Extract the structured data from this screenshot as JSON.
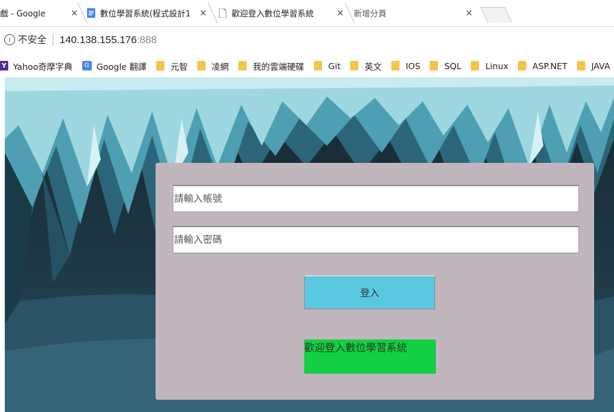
{
  "tabs": [
    {
      "label": "戲 - Google",
      "active": false
    },
    {
      "label": "數位學習系統(程式設計1",
      "active": false
    },
    {
      "label": "歡迎登入數位學習系統",
      "active": true
    },
    {
      "label": "新增分頁",
      "active": false
    }
  ],
  "tab_close": "×",
  "address": {
    "info_icon": "ⓘ",
    "security_label": "不安全",
    "url_host": "140.138.155.176",
    "url_port": ":888"
  },
  "bookmarks": [
    {
      "label": "Yahoo奇摩字典",
      "icon": "yahoo-icon"
    },
    {
      "label": "Google 翻譯",
      "icon": "google-translate-icon"
    },
    {
      "label": "元智",
      "icon": "folder-icon"
    },
    {
      "label": "凌網",
      "icon": "folder-icon"
    },
    {
      "label": "我的雲端硬碟",
      "icon": "folder-icon"
    },
    {
      "label": "Git",
      "icon": "folder-icon"
    },
    {
      "label": "英文",
      "icon": "folder-icon"
    },
    {
      "label": "IOS",
      "icon": "folder-icon"
    },
    {
      "label": "SQL",
      "icon": "folder-icon"
    },
    {
      "label": "Linux",
      "icon": "folder-icon"
    },
    {
      "label": "ASP.NET",
      "icon": "folder-icon"
    },
    {
      "label": "JAVA",
      "icon": "folder-icon"
    }
  ],
  "login": {
    "account_placeholder": "請輸入帳號",
    "password_placeholder": "請輸入密碼",
    "submit_label": "登入",
    "welcome_text": "歡迎登入數位學習系統"
  },
  "colors": {
    "panel": "#c2b6be",
    "button": "#5bc8e2",
    "welcome": "#13cf43",
    "cave_dark": "#1d3240",
    "ice_light": "#9fd7e0",
    "ice_mid": "#4e9fb3"
  }
}
